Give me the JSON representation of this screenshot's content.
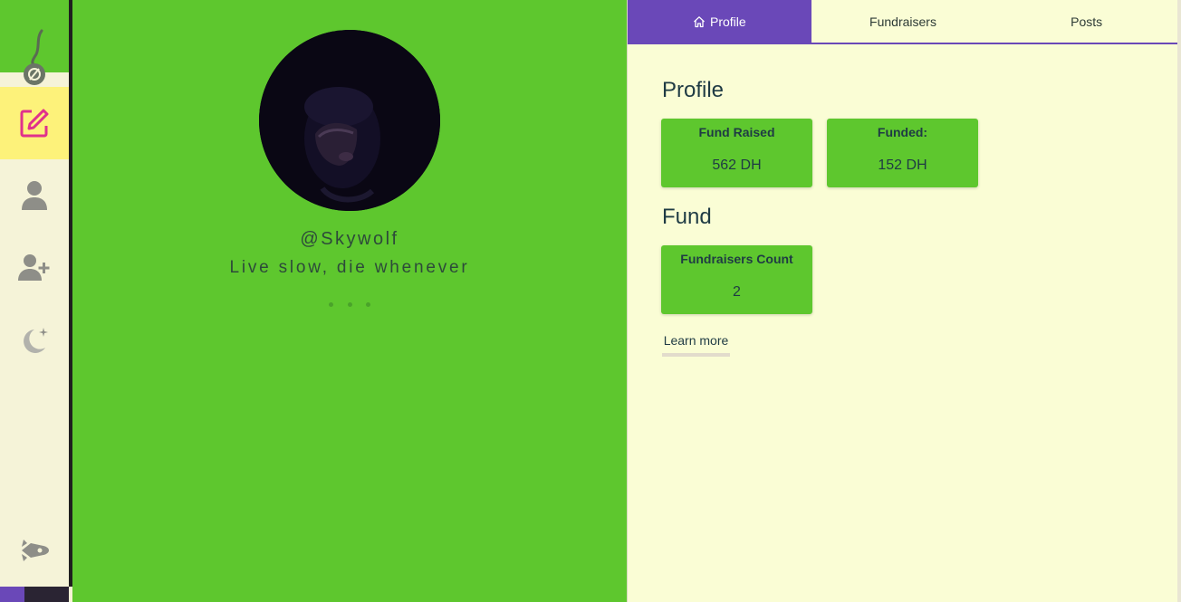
{
  "sidebar": {
    "items": [
      {
        "name": "create-post",
        "icon": "edit-icon",
        "active": true
      },
      {
        "name": "profile",
        "icon": "user-icon"
      },
      {
        "name": "add-user",
        "icon": "user-plus-icon"
      },
      {
        "name": "theme",
        "icon": "moon-stars-icon"
      },
      {
        "name": "logout",
        "icon": "rocket-icon"
      }
    ]
  },
  "profile_panel": {
    "username": "@Skywolf",
    "bio": "Live slow, die whenever"
  },
  "tabs": [
    {
      "label": "Profile",
      "icon": "home-icon",
      "active": true
    },
    {
      "label": "Fundraisers"
    },
    {
      "label": "Posts"
    }
  ],
  "profile_section": {
    "title": "Profile",
    "stats": [
      {
        "label": "Fund Raised",
        "value": "562 DH"
      },
      {
        "label": "Funded:",
        "value": "152 DH"
      }
    ]
  },
  "fund_section": {
    "title": "Fund",
    "stats": [
      {
        "label": "Fundraisers Count",
        "value": "2"
      }
    ]
  },
  "learn_more": "Learn more",
  "colors": {
    "green": "#5ec72e",
    "purple": "#6a48b8",
    "cream": "#fafdd5",
    "active_highlight": "#fdf27a",
    "edit_pink": "#e0318c"
  }
}
